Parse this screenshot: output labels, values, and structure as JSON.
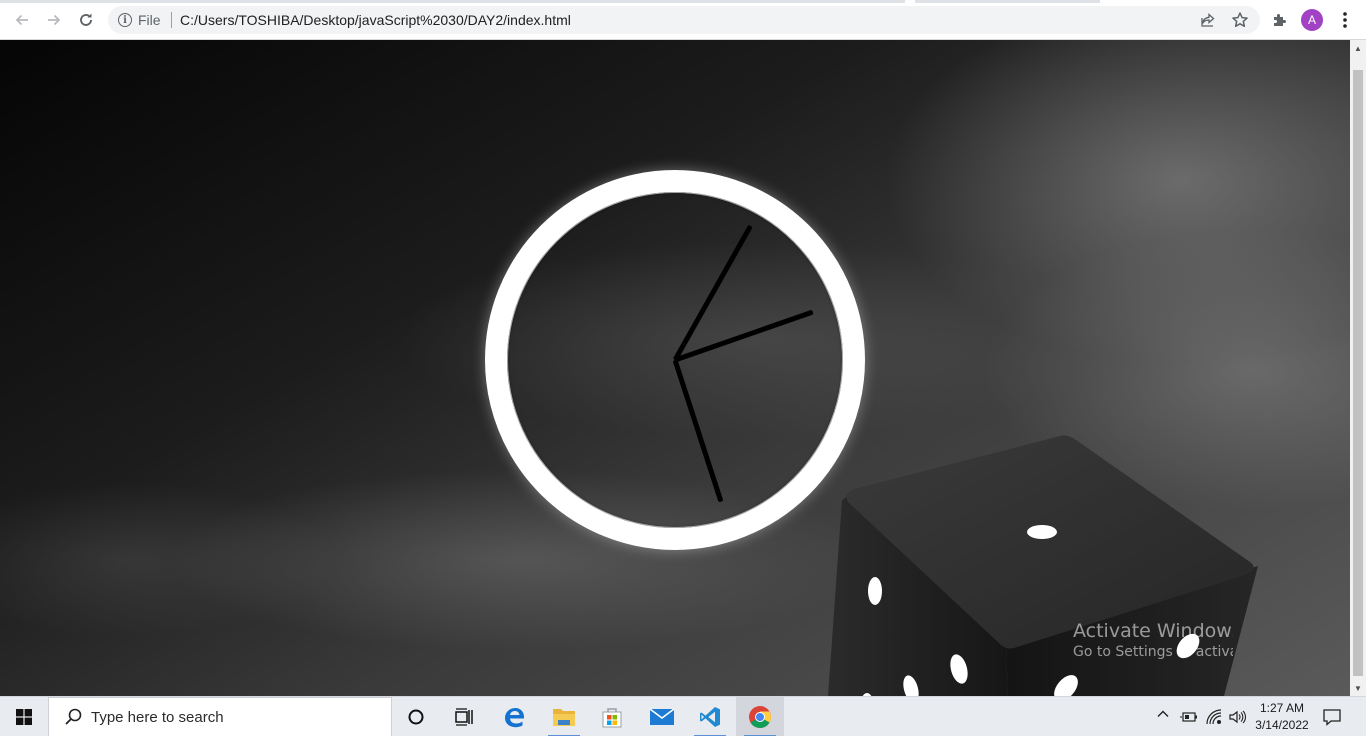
{
  "browser": {
    "site_info_label": "File",
    "url": "C:/Users/TOSHIBA/Desktop/javaScript%2030/DAY2/index.html",
    "profile_initial": "A",
    "icons": {
      "back": "arrow-left-icon",
      "forward": "arrow-right-icon",
      "reload": "reload-icon",
      "info": "info-icon",
      "share": "share-icon",
      "bookmark": "star-icon",
      "extensions": "puzzle-icon",
      "menu": "kebab-menu-icon"
    }
  },
  "page": {
    "clock": {
      "face_color": "#ffffff",
      "hand_color": "#000000"
    },
    "dice": {
      "body_color": "#1e1e1e",
      "pip_color": "#ffffff"
    }
  },
  "watermark": {
    "title": "Activate Windows",
    "subtitle": "Go to Settings to activate Windows."
  },
  "taskbar": {
    "search_placeholder": "Type here to search",
    "apps": [
      "cortana",
      "task-view",
      "edge",
      "file-explorer",
      "microsoft-store",
      "mail",
      "vscode",
      "chrome"
    ],
    "tray": {
      "time": "1:27 AM",
      "date": "3/14/2022"
    }
  }
}
